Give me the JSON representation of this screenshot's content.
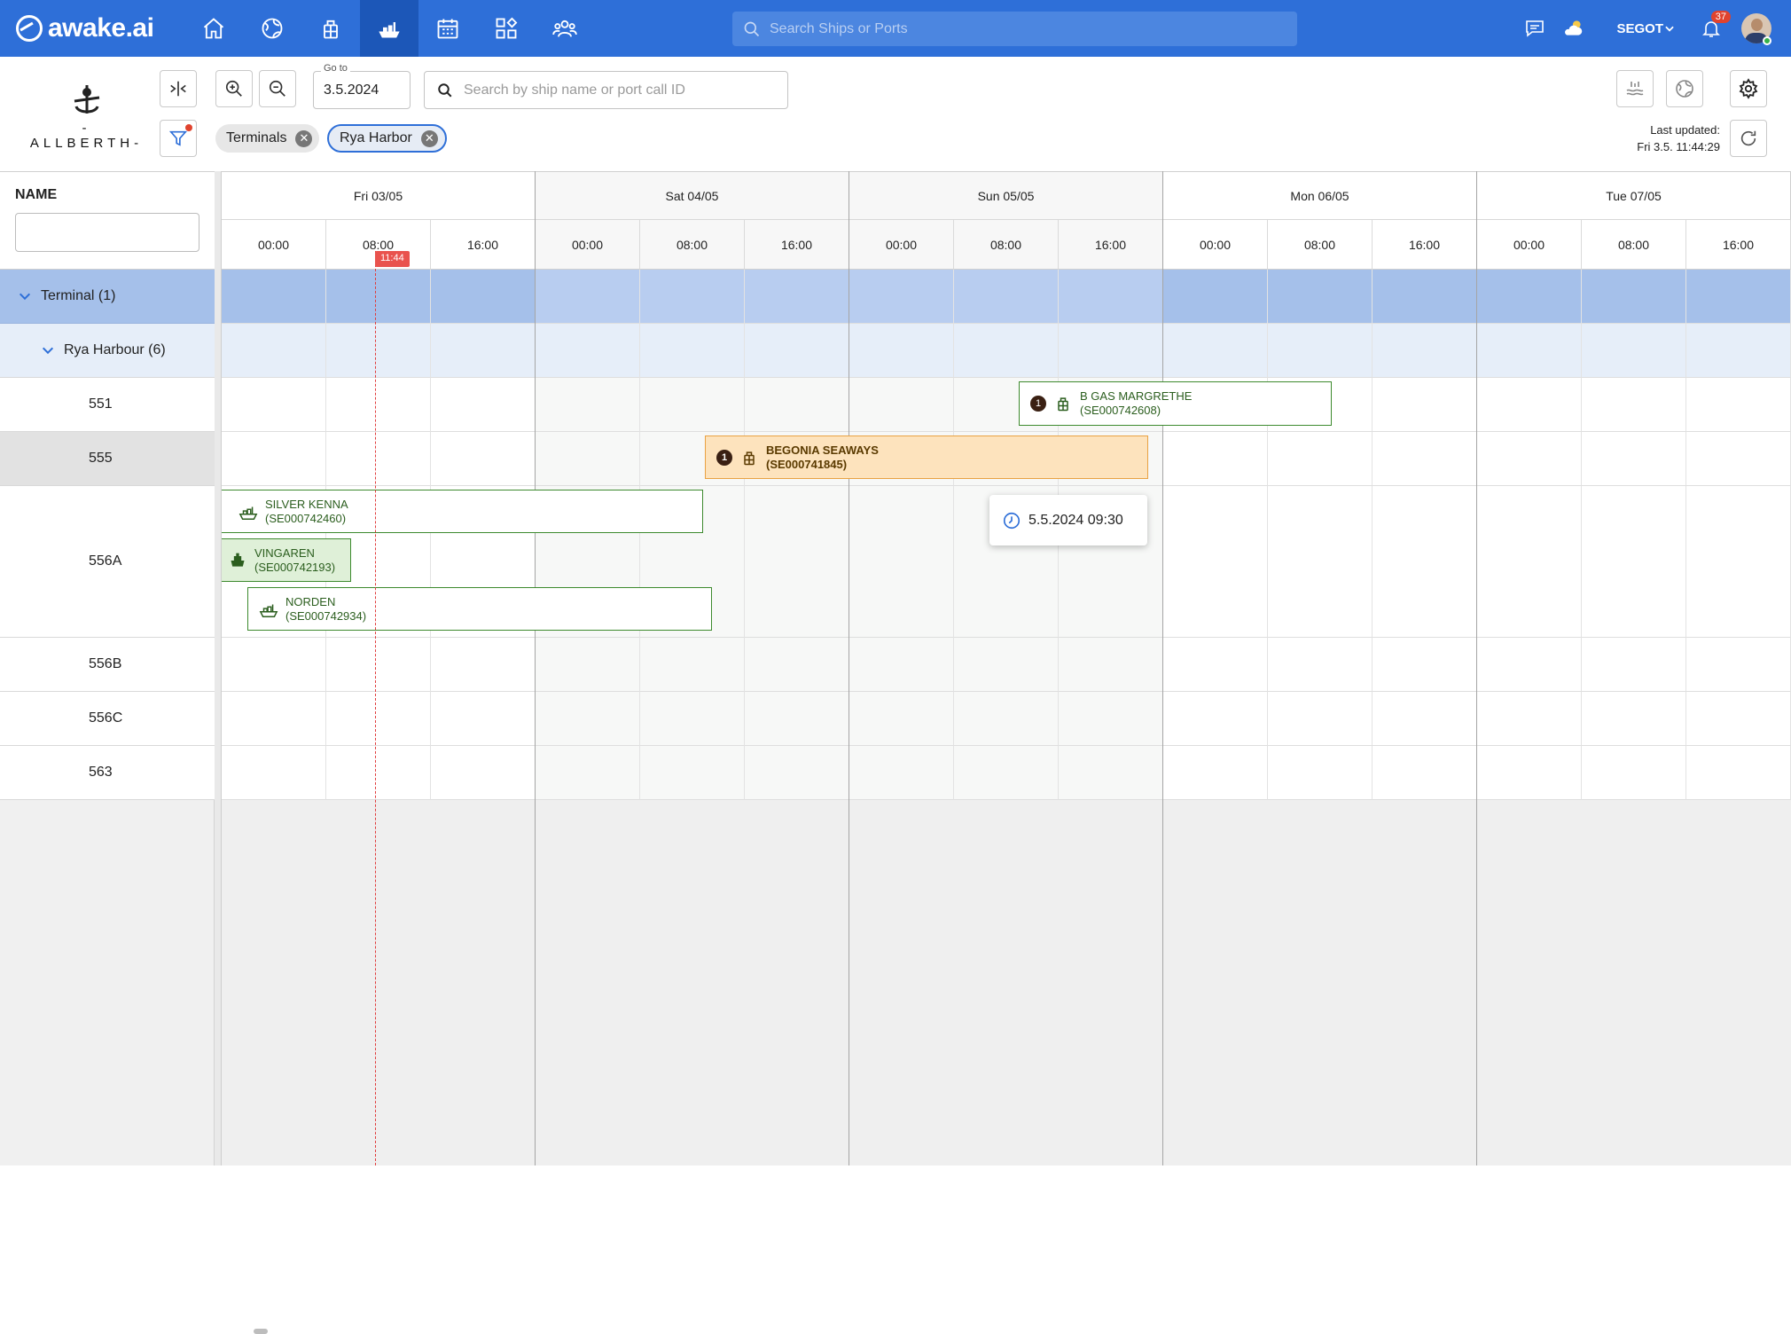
{
  "topbar": {
    "logo_text": "awake.ai",
    "nav_icons": [
      "home-icon",
      "globe-icon",
      "cargo-icon",
      "berth-icon",
      "calendar-icon",
      "apps-icon",
      "people-icon"
    ],
    "active_nav": "berth-icon",
    "search_placeholder": "Search Ships or Ports",
    "org": "SEGOT",
    "notifications_count": "37",
    "colors": {
      "bar": "#2e6fd8",
      "active": "#1c57b8",
      "badge": "#e0432e"
    }
  },
  "toolbar": {
    "brand": "-ALLBERTH-",
    "goto_label": "Go to",
    "goto_value": "3.5.2024",
    "search_placeholder": "Search by ship name or port call ID",
    "chips": [
      {
        "label": "Terminals",
        "selected": false
      },
      {
        "label": "Rya Harbor",
        "selected": true
      }
    ],
    "last_updated_label": "Last updated:",
    "last_updated_value": "Fri 3.5. 11:44:29"
  },
  "grid": {
    "name_header": "NAME",
    "group": "Terminal (1)",
    "subgroup": "Rya Harbour (6)",
    "berths": [
      "551",
      "555",
      "556A",
      "556B",
      "556C",
      "563"
    ],
    "days": [
      "Fri 03/05",
      "Sat 04/05",
      "Sun 05/05",
      "Mon 06/05",
      "Tue 07/05"
    ],
    "hours": [
      "00:00",
      "08:00",
      "16:00"
    ],
    "now_label": "11:44"
  },
  "calls": [
    {
      "name": "B GAS MARGRETHE",
      "id": "(SE000742608)",
      "berth": "551",
      "count": "1",
      "icon": "cargo-icon",
      "style": "outline"
    },
    {
      "name": "BEGONIA SEAWAYS",
      "id": "(SE000741845)",
      "berth": "555",
      "count": "1",
      "icon": "cargo-icon",
      "style": "orange"
    },
    {
      "name": "SILVER KENNA",
      "id": "(SE000742460)",
      "berth": "556A",
      "icon": "ship-cargo-icon",
      "style": "outline"
    },
    {
      "name": "VINGAREN",
      "id": "(SE000742193)",
      "berth": "556A",
      "icon": "ship-icon",
      "style": "green"
    },
    {
      "name": "NORDEN",
      "id": "(SE000742934)",
      "berth": "556A",
      "icon": "ship-cargo-icon",
      "style": "outline"
    }
  ],
  "tooltip": {
    "text": "5.5.2024 09:30",
    "icon": "clock-icon"
  }
}
